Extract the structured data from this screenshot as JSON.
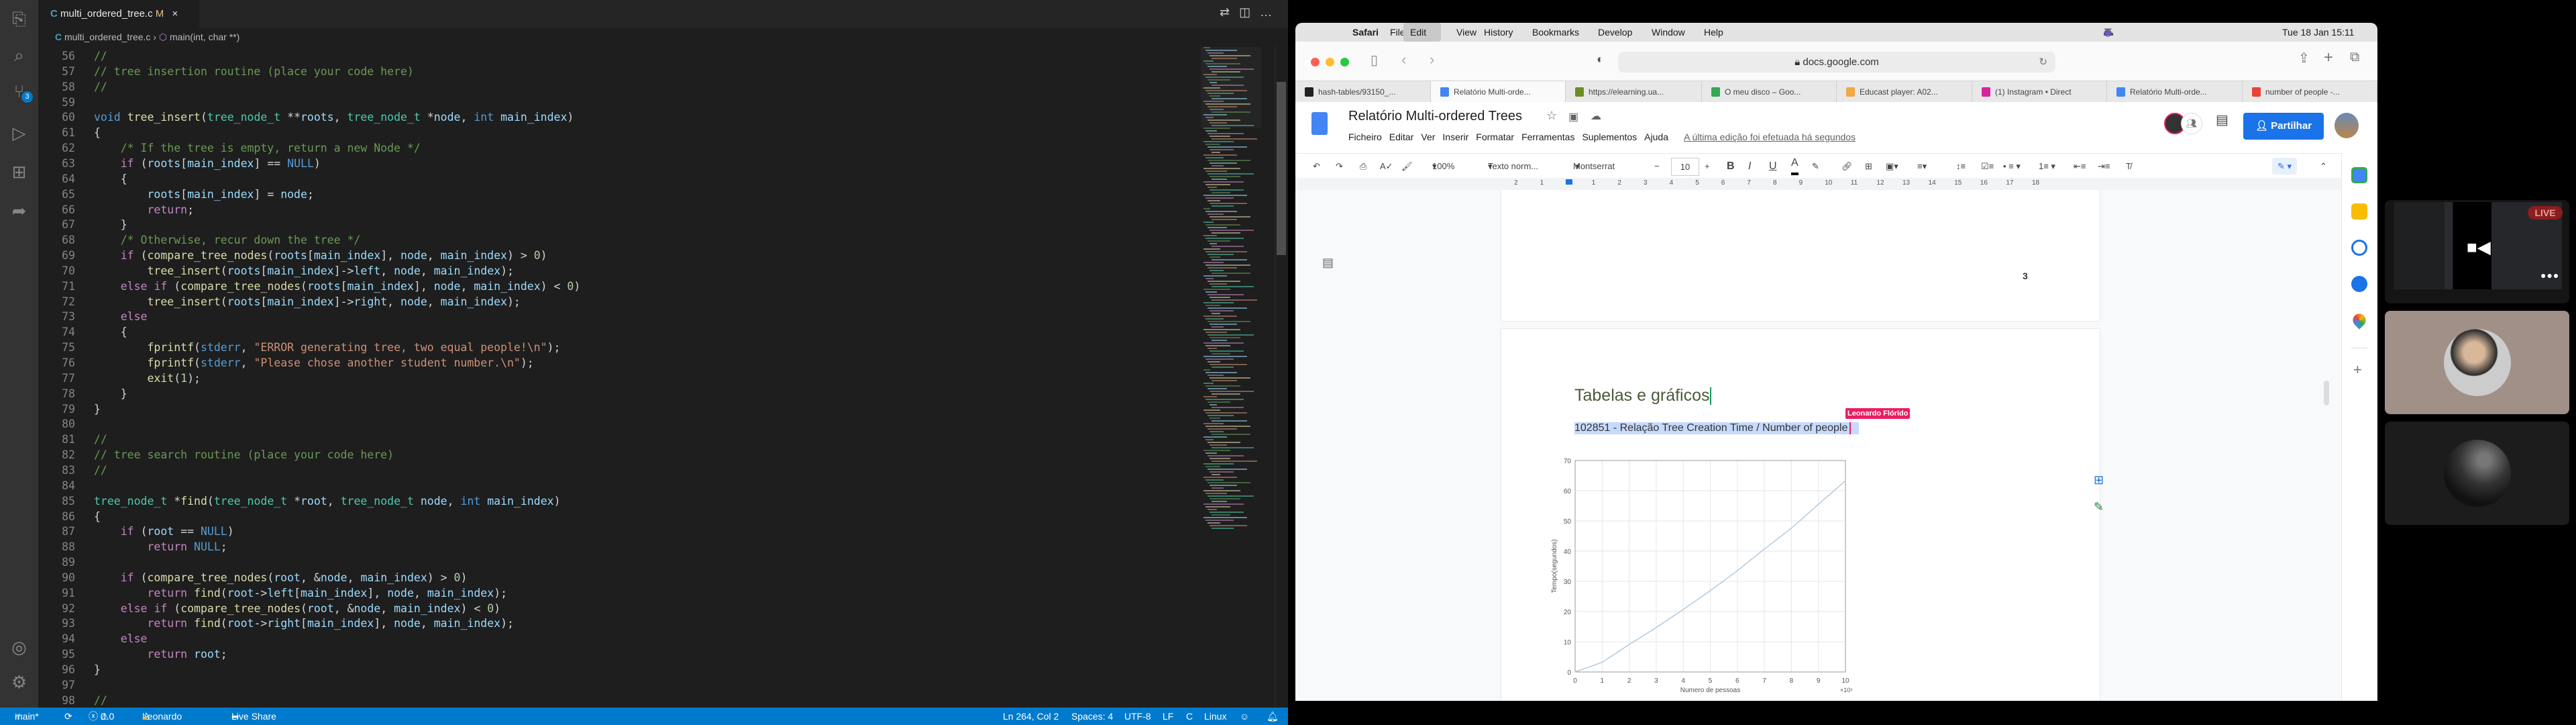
{
  "vscode": {
    "tab": {
      "filename": "multi_ordered_tree.c",
      "modified": "M",
      "close": "×",
      "lang_icon": "C"
    },
    "breadcrumb": {
      "file": "multi_ordered_tree.c",
      "separator": "›",
      "symbol": "main(int, char **)"
    },
    "activity_bar": [
      "explorer-icon",
      "search-icon",
      "source-control-icon",
      "run-debug-icon",
      "extensions-icon",
      "live-share-icon",
      "account-icon",
      "settings-icon"
    ],
    "scm_badge": "3",
    "code_lines": [
      {
        "n": "56",
        "text": "//"
      },
      {
        "n": "57",
        "text": "// tree insertion routine (place your code here)"
      },
      {
        "n": "58",
        "text": "//"
      },
      {
        "n": "59",
        "text": ""
      },
      {
        "n": "60",
        "text": "void tree_insert(tree_node_t **roots, tree_node_t *node, int main_index)"
      },
      {
        "n": "61",
        "text": "{"
      },
      {
        "n": "62",
        "text": "    /* If the tree is empty, return a new Node */"
      },
      {
        "n": "63",
        "text": "    if (roots[main_index] == NULL)"
      },
      {
        "n": "64",
        "text": "    {"
      },
      {
        "n": "65",
        "text": "        roots[main_index] = node;"
      },
      {
        "n": "66",
        "text": "        return;"
      },
      {
        "n": "67",
        "text": "    }"
      },
      {
        "n": "68",
        "text": "    /* Otherwise, recur down the tree */"
      },
      {
        "n": "69",
        "text": "    if (compare_tree_nodes(roots[main_index], node, main_index) > 0)"
      },
      {
        "n": "70",
        "text": "        tree_insert(roots[main_index]->left, node, main_index);"
      },
      {
        "n": "71",
        "text": "    else if (compare_tree_nodes(roots[main_index], node, main_index) < 0)"
      },
      {
        "n": "72",
        "text": "        tree_insert(roots[main_index]->right, node, main_index);"
      },
      {
        "n": "73",
        "text": "    else"
      },
      {
        "n": "74",
        "text": "    {"
      },
      {
        "n": "75",
        "text": "        fprintf(stderr, \"ERROR generating tree, two equal people!\\n\");"
      },
      {
        "n": "76",
        "text": "        fprintf(stderr, \"Please chose another student number.\\n\");"
      },
      {
        "n": "77",
        "text": "        exit(1);"
      },
      {
        "n": "78",
        "text": "    }"
      },
      {
        "n": "79",
        "text": "}"
      },
      {
        "n": "80",
        "text": ""
      },
      {
        "n": "81",
        "text": "//"
      },
      {
        "n": "82",
        "text": "// tree search routine (place your code here)"
      },
      {
        "n": "83",
        "text": "//"
      },
      {
        "n": "84",
        "text": ""
      },
      {
        "n": "85",
        "text": "tree_node_t *find(tree_node_t *root, tree_node_t node, int main_index)"
      },
      {
        "n": "86",
        "text": "{"
      },
      {
        "n": "87",
        "text": "    if (root == NULL)"
      },
      {
        "n": "88",
        "text": "        return NULL;"
      },
      {
        "n": "89",
        "text": ""
      },
      {
        "n": "90",
        "text": "    if (compare_tree_nodes(root, &node, main_index) > 0)"
      },
      {
        "n": "91",
        "text": "        return find(root->left[main_index], node, main_index);"
      },
      {
        "n": "92",
        "text": "    else if (compare_tree_nodes(root, &node, main_index) < 0)"
      },
      {
        "n": "93",
        "text": "        return find(root->right[main_index], node, main_index);"
      },
      {
        "n": "94",
        "text": "    else"
      },
      {
        "n": "95",
        "text": "        return root;"
      },
      {
        "n": "96",
        "text": "}"
      },
      {
        "n": "97",
        "text": ""
      },
      {
        "n": "98",
        "text": "//"
      }
    ],
    "status": {
      "branch": "main*",
      "errors": "0",
      "warnings": "0",
      "user": "Leonardo",
      "live_share": "Live Share",
      "position": "Ln 264, Col 2",
      "spaces": "Spaces: 4",
      "encoding": "UTF-8",
      "eol": "LF",
      "language": "C",
      "platform": "Linux"
    },
    "colors": {
      "statusbar": "#007acc",
      "editor_bg": "#1e1e1e"
    }
  },
  "macos_menubar": {
    "items": [
      "Safari",
      "File",
      "Edit",
      "View",
      "History",
      "Bookmarks",
      "Develop",
      "Window",
      "Help"
    ],
    "active_item": "Edit",
    "datetime": "Tue 18 Jan  15:11"
  },
  "safari": {
    "address": "docs.google.com",
    "tabs": [
      {
        "label": "hash-tables/93150_...",
        "icon": "github-icon"
      },
      {
        "label": "Relatório Multi-orde...",
        "icon": "google-docs-icon",
        "active": true
      },
      {
        "label": "https://elearning.ua...",
        "icon": "elearning-icon"
      },
      {
        "label": "O meu disco – Goo...",
        "icon": "google-drive-icon"
      },
      {
        "label": "Educast player: A02...",
        "icon": "educast-icon"
      },
      {
        "label": "(1) Instagram • Direct",
        "icon": "instagram-icon"
      },
      {
        "label": "Relatório Multi-orde...",
        "icon": "google-docs-icon"
      },
      {
        "label": "number of people -...",
        "icon": "google-icon"
      }
    ]
  },
  "docs": {
    "title": "Relatório Multi-ordered Trees",
    "menu": [
      "Ficheiro",
      "Editar",
      "Ver",
      "Inserir",
      "Formatar",
      "Ferramentas",
      "Suplementos",
      "Ajuda"
    ],
    "last_edit": "A última edição foi efetuada há segundos",
    "share_label": "Partilhar",
    "toolbar": {
      "zoom": "100%",
      "style": "Texto norm...",
      "font": "Montserrat",
      "font_size": "10",
      "minus": "−",
      "plus": "+",
      "bold": "B",
      "italic": "I",
      "underline": "U",
      "text_color": "A"
    },
    "ruler": [
      "2",
      "1",
      "",
      "1",
      "2",
      "3",
      "4",
      "5",
      "6",
      "7",
      "8",
      "9",
      "10",
      "11",
      "12",
      "13",
      "14",
      "15",
      "16",
      "17",
      "18"
    ],
    "page_number": "3",
    "heading": "Tabelas e gráficos",
    "caption": "102851 - Relação Tree Creation Time / Number of people",
    "collaborator_label": "Leonardo Flórido",
    "colors": {
      "share_button": "#1a73e8",
      "collaborator": "#e91e63",
      "selection": "#c6dafc"
    }
  },
  "chart_data": {
    "type": "line",
    "x": [
      0,
      1,
      2,
      3,
      4,
      5,
      6,
      7,
      8,
      9,
      10
    ],
    "series": [
      {
        "values": [
          0,
          3.2,
          9.1,
          14.7,
          20.7,
          26.9,
          33.5,
          40.7,
          47.6,
          55.5,
          63.3
        ]
      }
    ],
    "xlabel": "Numero de pessoas",
    "ylabel": "Tempo(segundos)",
    "x_scale_label": "×10⁵",
    "xlim": [
      0,
      10
    ],
    "ylim": [
      0,
      70
    ],
    "xticks": [
      "0",
      "1",
      "2",
      "3",
      "4",
      "5",
      "6",
      "7",
      "8",
      "9",
      "10"
    ],
    "yticks": [
      "0",
      "10",
      "20",
      "30",
      "40",
      "50",
      "60",
      "70"
    ],
    "grid": true,
    "line_color": "#a8c4dc"
  },
  "call_panel": {
    "live_badge": "LIVE",
    "tiles": [
      "screen-share-tile",
      "participant-tile",
      "participant-tile"
    ],
    "colors": {
      "live": "#8b1e1e",
      "tile2_bg": "#a09088",
      "tile3_bg": "#1c1c1c"
    }
  }
}
